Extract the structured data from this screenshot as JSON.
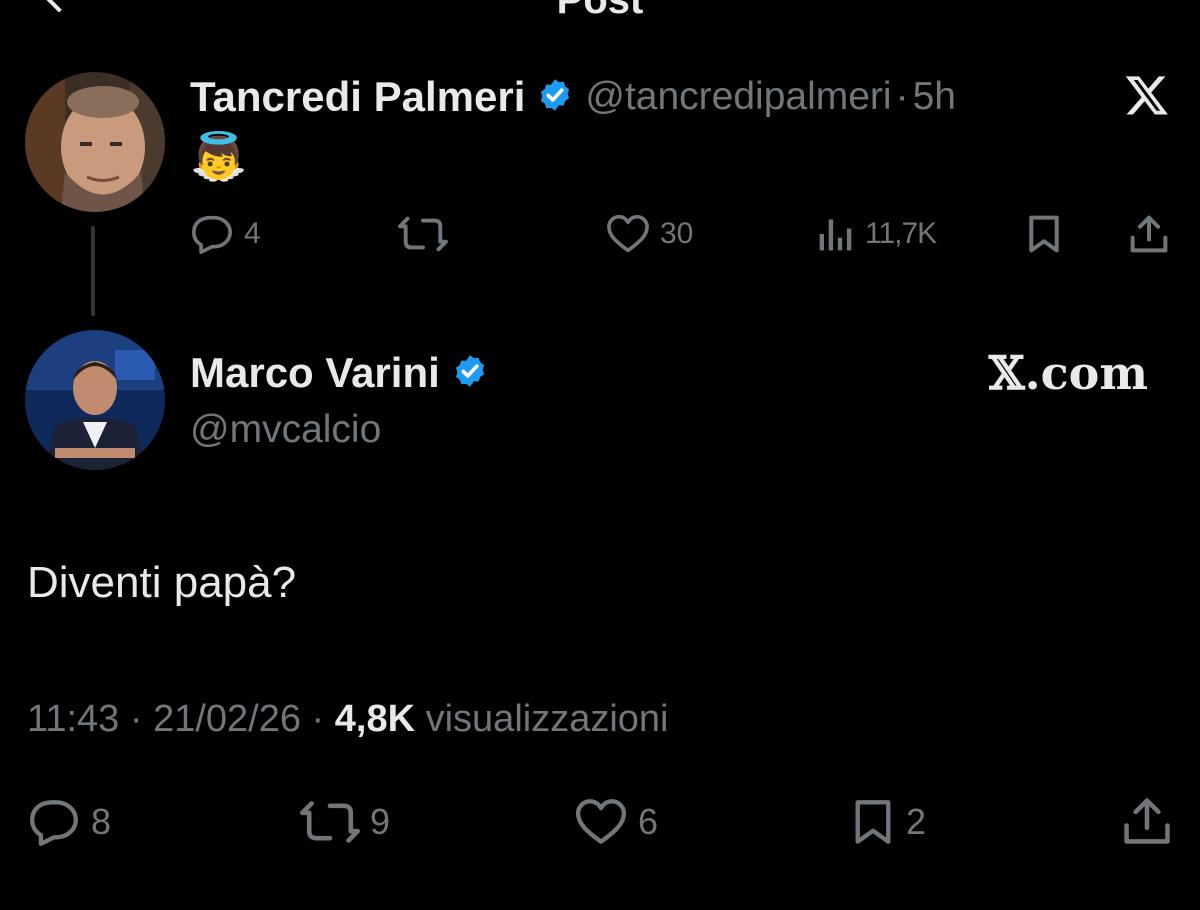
{
  "header": {
    "title": "Post"
  },
  "reply_to": {
    "name": "Tancredi Palmeri",
    "handle": "@tancredipalmeri",
    "sep": "·",
    "age": "5h",
    "text": "👼",
    "actions": {
      "replies": "4",
      "likes": "30",
      "views": "11,7K"
    }
  },
  "post": {
    "name": "Marco Varini",
    "handle": "@mvcalcio",
    "brand": "𝕏.com",
    "text": "Diventi papà?",
    "time": "11:43",
    "sep1": "·",
    "date": "21/02/26",
    "sep2": "·",
    "views_count": "4,8K",
    "views_label": "visualizzazioni",
    "actions": {
      "replies": "8",
      "reposts": "9",
      "likes": "6",
      "bookmarks": "2"
    }
  },
  "colors": {
    "verified": "#1d9bf0",
    "muted": "#71767b",
    "text": "#e7e9ea",
    "background": "#000000"
  }
}
